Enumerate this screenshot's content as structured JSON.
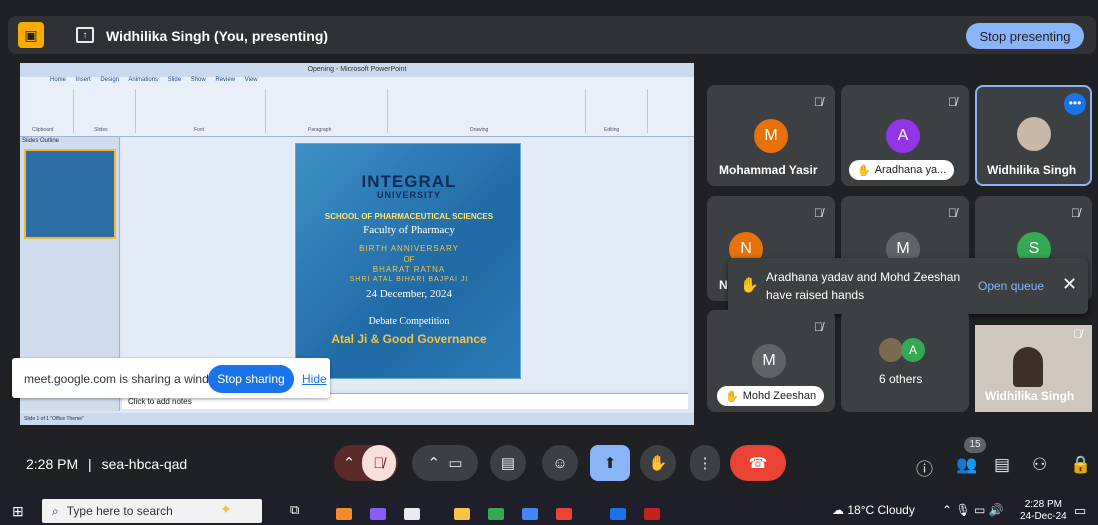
{
  "topbar": {
    "presenting_text": "Widhilika Singh (You, presenting)",
    "stop_presenting": "Stop presenting"
  },
  "ppt": {
    "window_title": "Opening - Microsoft PowerPoint",
    "ribbon_tabs": "Home Insert Design Animations Slide Show Review View",
    "groups": [
      "Clipboard",
      "Slides",
      "Font",
      "Paragraph",
      "Drawing",
      "Editing"
    ],
    "left_tabs": "Slides  Outline",
    "notes_placeholder": "Click to add notes",
    "status": "Slide 1 of 1   \"Office Theme\""
  },
  "slide": {
    "brand_line1": "INTEGRAL",
    "brand_line2": "UNIVERSITY",
    "school": "SCHOOL OF PHARMACEUTICAL SCIENCES",
    "faculty": "Faculty of Pharmacy",
    "occasion": "BIRTH ANNIVERSARY",
    "of": "OF",
    "title1": "BHARAT RATNA",
    "title2": "SHRI ATAL BIHARI BAJPAI JI",
    "date": "24 December, 2024",
    "event": "Debate Competition",
    "topic": "Atal Ji & Good Governance"
  },
  "sharing": {
    "message": "meet.google.com is sharing a window.",
    "stop_label": "Stop sharing",
    "hide_label": "Hide"
  },
  "participants": [
    {
      "initial": "M",
      "name": "Mohammad Yasir",
      "color": "#e8710a"
    },
    {
      "initial": "A",
      "name": "Aradhana ya...",
      "color": "#9334e6"
    },
    {
      "name": "Widhilika Singh"
    },
    {
      "initial": "N",
      "name": "N",
      "color": "#e8710a"
    },
    {
      "initial": "M",
      "name": "",
      "color": "#5f6368"
    },
    {
      "initial": "S",
      "name": "",
      "color": "#34a853"
    },
    {
      "initial": "M",
      "name": "Mohd Zeeshan",
      "color": "#5f6368"
    },
    {
      "initial": "A",
      "name": "6 others",
      "color": "#34a853"
    },
    {
      "name": "Widhilika Singh"
    }
  ],
  "hand_toast": {
    "line1": "Aradhana yadav and Mohd Zeeshan",
    "line2": "have raised hands",
    "action": "Open queue"
  },
  "bottom": {
    "time": "2:28 PM",
    "separator": "|",
    "meeting_code": "sea-hbca-qad",
    "people_count": "15"
  },
  "taskbar": {
    "search_placeholder": "Type here to search",
    "weather": "18°C  Cloudy",
    "clock_time": "2:28 PM",
    "clock_date": "24-Dec-24"
  }
}
